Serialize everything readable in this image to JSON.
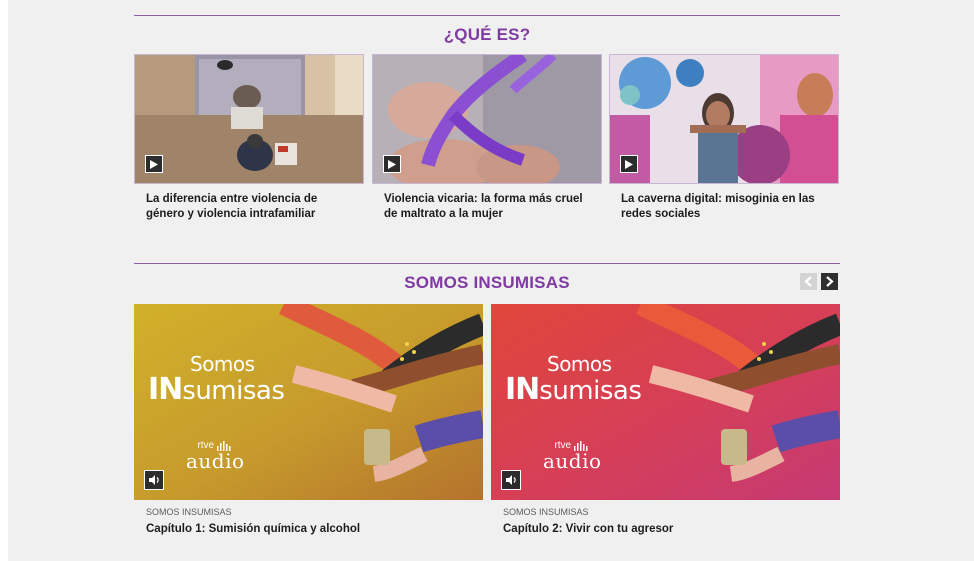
{
  "sections": {
    "que_es": {
      "title": "¿QUÉ ES?",
      "videos": [
        {
          "title": "La diferencia entre violencia de género y violencia intrafamiliar",
          "icon": "play-icon"
        },
        {
          "title": "Violencia vicaria: la forma más cruel de maltrato a la mujer",
          "icon": "play-icon"
        },
        {
          "title": "La caverna digital: misoginia en las redes sociales",
          "icon": "play-icon"
        }
      ]
    },
    "somos_insumisas": {
      "title": "SOMOS INSUMISAS",
      "prev_icon": "chevron-left-icon",
      "next_icon": "chevron-right-icon",
      "episodes": [
        {
          "kicker": "SOMOS INSUMISAS",
          "title": "Capítulo 1: Sumisión química y alcohol",
          "brand_somos": "Somos",
          "brand_in": "IN",
          "brand_sumisas": "sumisas",
          "rtve": "rtve",
          "audio": "audio",
          "icon": "speaker-icon"
        },
        {
          "kicker": "SOMOS INSUMISAS",
          "title": "Capítulo 2: Vivir con tu agresor",
          "brand_somos": "Somos",
          "brand_in": "IN",
          "brand_sumisas": "sumisas",
          "rtve": "rtve",
          "audio": "audio",
          "icon": "speaker-icon"
        }
      ]
    }
  },
  "colors": {
    "accent": "#7f3aa3",
    "rule": "#8e5da7",
    "page_bg": "#f0f0f0"
  }
}
